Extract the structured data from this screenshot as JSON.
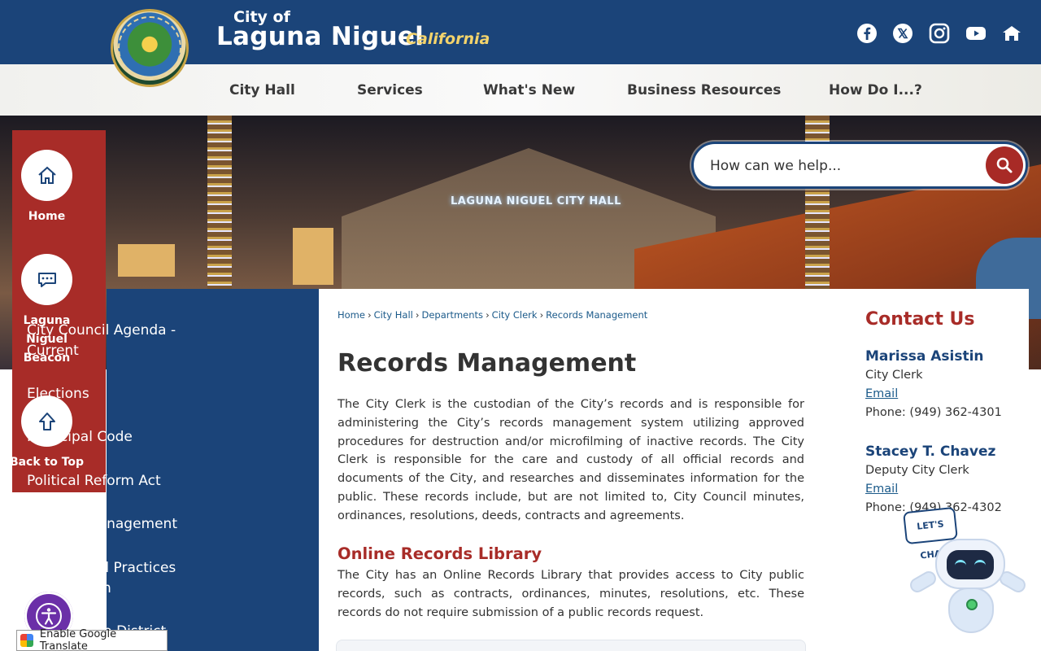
{
  "header": {
    "city_of": "City of",
    "city_name": "Laguna Niguel",
    "state": "California",
    "seal_text": "City of Laguna Niguel 1989",
    "social": [
      "facebook-icon",
      "x-icon",
      "instagram-icon",
      "youtube-icon",
      "nextdoor-icon"
    ]
  },
  "nav": {
    "items": [
      "City Hall",
      "Services",
      "What's New",
      "Business Resources",
      "How Do I...?"
    ]
  },
  "hero": {
    "sign_text": "LAGUNA NIGUEL CITY HALL"
  },
  "search": {
    "placeholder": "How can we help..."
  },
  "quicklinks": [
    {
      "label": "Home",
      "icon": "home-icon"
    },
    {
      "label": "Laguna Nigue​l Beacon",
      "icon": "chat-icon"
    },
    {
      "label": "Back to Top",
      "icon": "arrow-up-icon"
    }
  ],
  "sidenav": {
    "items": [
      "City Council Agenda - Current",
      "Elections",
      "Municipal Code",
      "Political Reform Act",
      "Records Management",
      "Fair Political Practices Commission",
      "Transition to District"
    ]
  },
  "breadcrumb": [
    "Home",
    "City Hall",
    "Departments",
    "City Clerk",
    "Records Management"
  ],
  "main": {
    "title": "Records Management",
    "intro": "The City Clerk is the custodian of the City’s records and is responsible for administering the City’s records management system utilizing approved procedures for destruction and/or microfilming of inactive records. The City Clerk is responsible for the care and custody of all official records and documents of the City, and researches and disseminates information for the public. These records include, but are not limited to, City Council minutes, ordinances, resolutions, deeds, contracts and agreements.",
    "section_heading": "Online Records Library",
    "section_text": "The City has an Online Records Library that provides access to City public records, such as contracts, ordinances, minutes, resolutions, etc. These records do not require submission of a public records request."
  },
  "contact": {
    "title": "Contact Us",
    "people": [
      {
        "name": "Marissa Asistin",
        "role": "City Clerk",
        "email_label": "Email",
        "phone": "Phone: (949) 362-4301"
      },
      {
        "name": "Stacey T. Chavez",
        "role": "Deputy City Clerk",
        "email_label": "Email",
        "phone": "Phone: (949) 362-4302"
      }
    ]
  },
  "widgets": {
    "chat_label": "LET'S CHAT",
    "translate_label": "Enable Google Translate"
  },
  "colors": {
    "navy": "#1b4479",
    "red": "#a82c28",
    "gold": "#f3d36b"
  }
}
